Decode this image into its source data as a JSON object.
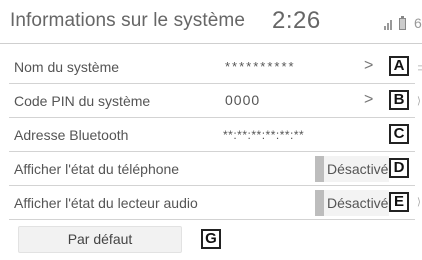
{
  "header": {
    "title": "Informations sur le système",
    "clock": "2:26"
  },
  "rows": [
    {
      "label": "Nom du système",
      "value": "**********",
      "callout": "A",
      "has_chevron": true
    },
    {
      "label": "Code PIN du système",
      "value": "0000",
      "callout": "B",
      "has_chevron": true
    },
    {
      "label": "Adresse Bluetooth",
      "value": "**:**:**:**:**:**",
      "callout": "C",
      "has_chevron": false
    },
    {
      "label": "Afficher l'état du téléphone",
      "toggle": "Désactivé",
      "callout": "D"
    },
    {
      "label": "Afficher l'état du lecteur audio",
      "toggle": "Désactivé",
      "callout": "E"
    }
  ],
  "chevron_glyph": ">",
  "default_button": {
    "label": "Par défaut",
    "callout": "G"
  },
  "icons": [
    "signal-icon",
    "battery-icon",
    "chevron-right-icon"
  ],
  "colors": {
    "background": "#ffffff",
    "divider": "#d3d3d3",
    "toggle_bar": "#bdbdbd",
    "text": "#555555"
  }
}
